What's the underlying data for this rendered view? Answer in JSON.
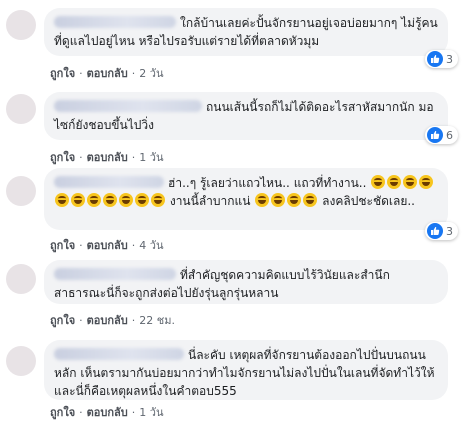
{
  "comments": [
    {
      "text": "ใกล้บ้านเลยค่ะปั้นจักรยานอยู่เจอบ่อยมากๆ ไม่รู้คนที่ดูแลไปอยู่ไหน หรือไปรอรับแต่รายได้ที่ตลาดหัวมุม",
      "like": "ถูกใจ",
      "reply": "ตอบกลับ",
      "time": "2 วัน",
      "reactions": "3"
    },
    {
      "text": "ถนนเส้นนี้รถก็ไม่ได้ติดอะไรสาหัสมากนัก มอไซก์ยังชอบขึ้นไปวิ่ง",
      "like": "ถูกใจ",
      "reply": "ตอบกลับ",
      "time": "1 วัน",
      "reactions": "6"
    },
    {
      "text_part1": "ฮ่า..ๆ รู้เลยว่าแถวไหน.. แถวที่ทำงาน..",
      "text_part2": "งานนี้ลำบากแน่",
      "text_part3": "ลงคลิปชะชัดเลย..",
      "like": "ถูกใจ",
      "reply": "ตอบกลับ",
      "time": "4 วัน",
      "reactions": "3"
    },
    {
      "text": "ที่สำคัญชุดความคิดแบบไร้วินัยและสำนึกสาธารณะนี่ก็จะถูกส่งต่อไปยังรุ่นลูกรุ่นหลาน",
      "like": "ถูกใจ",
      "reply": "ตอบกลับ",
      "time": "22 ชม."
    },
    {
      "text": "นี่ละคับ เหตุผลที่จักรยานต้องออกไปปั่นบนถนนหลัก เห็นตรามากันบ่อยมากว่าทำไมจักรยานไม่ลงไปปั่นในเลนที่จัดทำไว้ให้ และนี่ก็คือเหตุผลหนึ่งในคำตอบ555",
      "like": "ถูกใจ",
      "reply": "ตอบกลับ",
      "time": "1 วัน"
    }
  ],
  "colors": {
    "bubble": "#f2f3f5",
    "like_blue": "#1877f2",
    "meta": "#606770"
  }
}
